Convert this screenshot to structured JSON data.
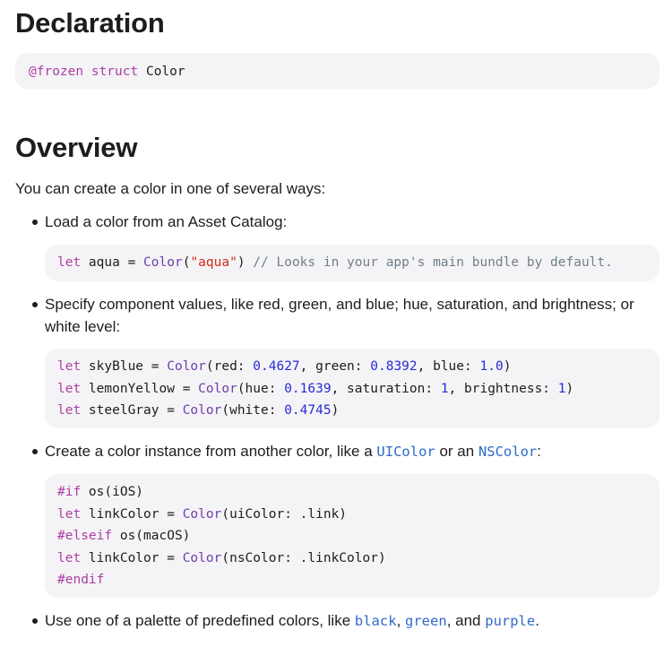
{
  "declaration": {
    "heading": "Declaration",
    "code": {
      "attr": "@frozen",
      "keyword": "struct",
      "name": "Color"
    }
  },
  "overview": {
    "heading": "Overview",
    "intro": "You can create a color in one of several ways:",
    "items": [
      {
        "text": "Load a color from an Asset Catalog:",
        "code": {
          "kw": "let",
          "name": " aqua = ",
          "type": "Color",
          "open": "(",
          "str": "\"aqua\"",
          "close": ") ",
          "comment": "// Looks in your app's main bundle by default."
        }
      },
      {
        "text": "Specify component values, like red, green, and blue; hue, saturation, and brightness; or white level:",
        "code": [
          {
            "kw": "let",
            "name": " skyBlue = ",
            "type": "Color",
            "a": "(red: ",
            "n1": "0.4627",
            "b": ", green: ",
            "n2": "0.8392",
            "c": ", blue: ",
            "n3": "1.0",
            "d": ")"
          },
          {
            "kw": "let",
            "name": " lemonYellow = ",
            "type": "Color",
            "a": "(hue: ",
            "n1": "0.1639",
            "b": ", saturation: ",
            "n2": "1",
            "c": ", brightness: ",
            "n3": "1",
            "d": ")"
          },
          {
            "kw": "let",
            "name": " steelGray = ",
            "type": "Color",
            "a": "(white: ",
            "n1": "0.4745",
            "d": ")"
          }
        ]
      },
      {
        "text_before": "Create a color instance from another color, like a ",
        "link1": "UIColor",
        "text_mid": " or an ",
        "link2": "NSColor",
        "text_after": ":",
        "code": [
          {
            "pp": "#if",
            "rest": " os(iOS)"
          },
          {
            "kw": "let",
            "name": " linkColor = ",
            "type": "Color",
            "rest": "(uiColor: .link)"
          },
          {
            "pp": "#elseif",
            "rest": " os(macOS)"
          },
          {
            "kw": "let",
            "name": " linkColor = ",
            "type": "Color",
            "rest": "(nsColor: .linkColor)"
          },
          {
            "pp": "#endif",
            "rest": ""
          }
        ]
      },
      {
        "text_before": "Use one of a palette of predefined colors, like ",
        "link1": "black",
        "sep1": ", ",
        "link2": "green",
        "sep2": ", and ",
        "link3": "purple",
        "text_after": "."
      }
    ]
  },
  "colors": {
    "link": "#2f6ac9",
    "keyword": "#ad3da4",
    "type": "#703daa",
    "number": "#272ad8",
    "string": "#d12f1b",
    "comment": "#707f8c",
    "code_bg": "#f4f4f6"
  }
}
